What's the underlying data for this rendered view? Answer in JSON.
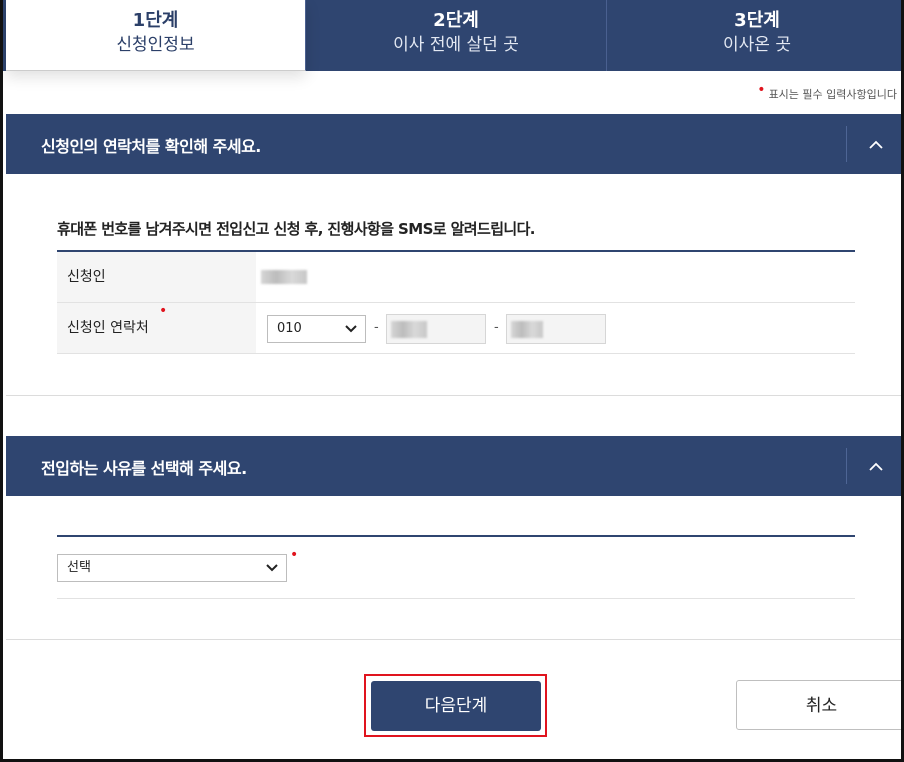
{
  "tabs": [
    {
      "step": "1단계",
      "name": "신청인정보"
    },
    {
      "step": "2단계",
      "name": "이사 전에 살던 곳"
    },
    {
      "step": "3단계",
      "name": "이사온 곳"
    }
  ],
  "required_note": "표시는 필수 입력사항입니다",
  "section1": {
    "title": "신청인의 연락처를 확인해 주세요.",
    "notice": "휴대폰 번호를 남겨주시면 전입신고 신청 후, 진행사항을 SMS로 알려드립니다.",
    "applicant_label": "신청인",
    "contact_label": "신청인 연락처",
    "phone_prefix": "010",
    "phone_separator": "-"
  },
  "section2": {
    "title": "전입하는 사유를 선택해 주세요.",
    "reason_select_value": "선택"
  },
  "buttons": {
    "next": "다음단계",
    "cancel": "취소"
  },
  "colors": {
    "primary": "#2f4570",
    "required": "#e0141e"
  }
}
